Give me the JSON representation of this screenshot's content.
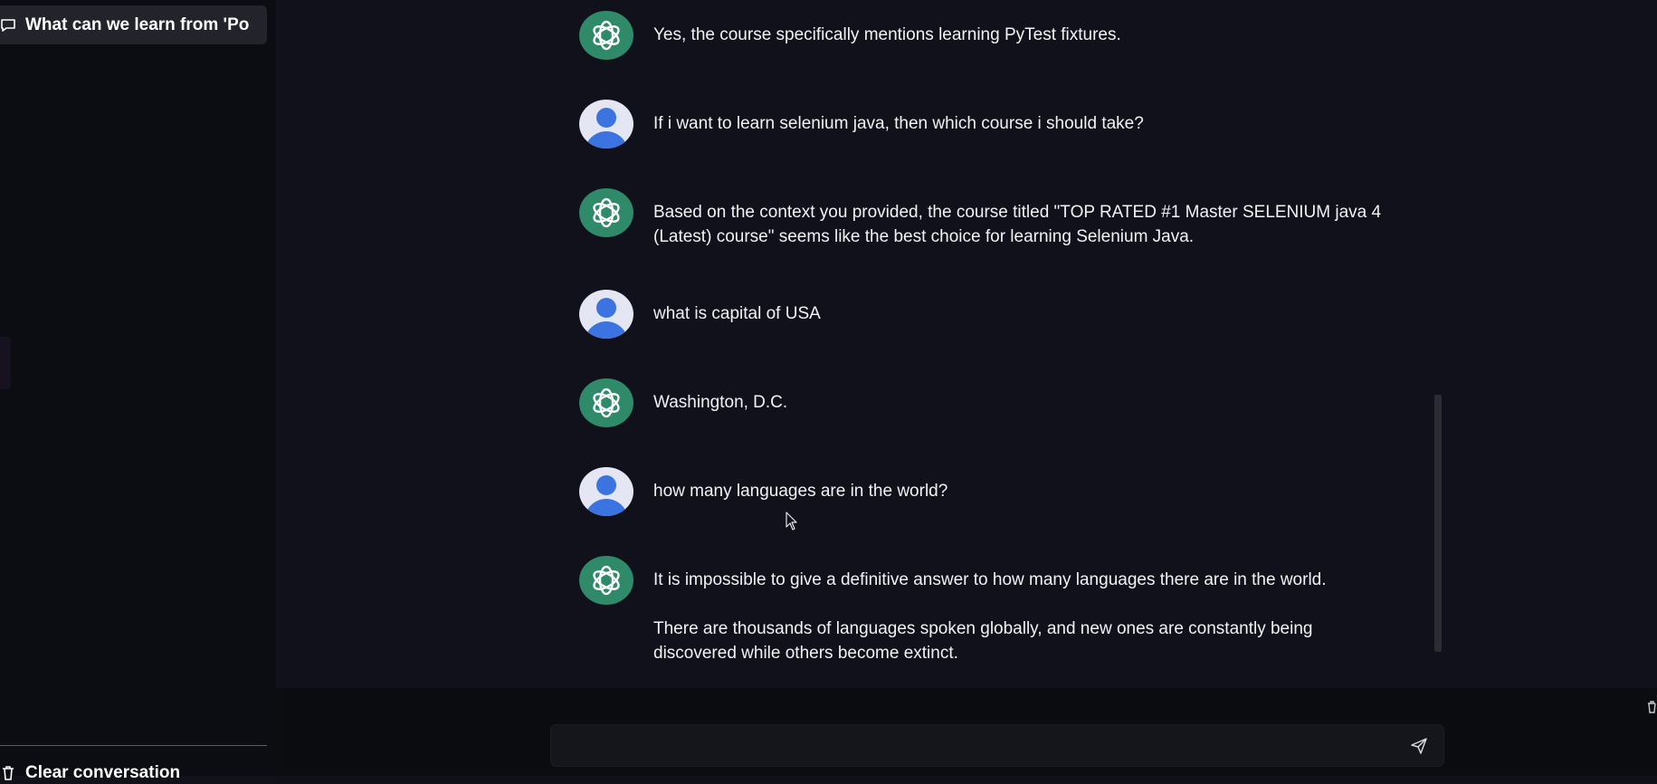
{
  "sidebar": {
    "conversation_title": "What can we learn from 'Po",
    "clear_label": "Clear conversation"
  },
  "messages": [
    {
      "role": "assistant",
      "paragraphs": [
        "Yes, the course specifically mentions learning PyTest fixtures."
      ]
    },
    {
      "role": "user",
      "paragraphs": [
        "If i want to learn selenium java, then which course i should take?"
      ]
    },
    {
      "role": "assistant",
      "paragraphs": [
        "Based on the context you provided, the course titled \"TOP RATED #1 Master SELENIUM java 4 (Latest) course\" seems like the best choice for learning Selenium Java."
      ]
    },
    {
      "role": "user",
      "paragraphs": [
        "what is capital of USA"
      ]
    },
    {
      "role": "assistant",
      "paragraphs": [
        "Washington, D.C."
      ]
    },
    {
      "role": "user",
      "paragraphs": [
        "how many languages are in the world?"
      ]
    },
    {
      "role": "assistant",
      "paragraphs": [
        "It is impossible to give a definitive answer to how many languages there are in the world.",
        "There are thousands of languages spoken globally, and new ones are constantly being discovered while others become extinct."
      ]
    }
  ],
  "composer": {
    "value": "",
    "placeholder": ""
  },
  "colors": {
    "assistant_avatar": "#2f8a69",
    "user_avatar_bg": "#e4e6f3",
    "user_avatar_fg": "#3b74e0",
    "background": "#10111b"
  }
}
